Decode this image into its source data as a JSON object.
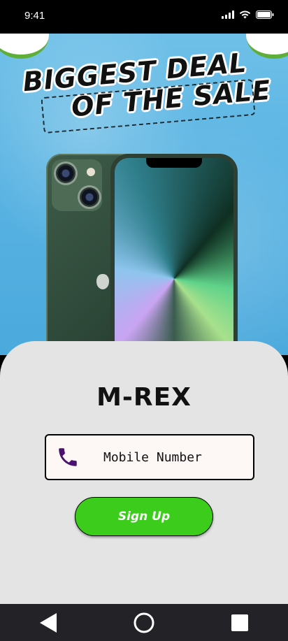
{
  "status_bar": {
    "time": "9:41",
    "icons": [
      "signal-icon",
      "wifi-icon",
      "battery-icon"
    ]
  },
  "hero": {
    "headline_line1": "BIGGEST DEAL",
    "headline_line2": "OF THE SALE",
    "background_color": "#5ab4e3",
    "product": "green smartphone"
  },
  "brand": {
    "name": "M-REX"
  },
  "phone_field": {
    "placeholder": "Mobile Number",
    "value": "",
    "icon": "phone-icon",
    "icon_color": "#4a1170"
  },
  "signup": {
    "label": "Sign Up",
    "color": "#3ccd1c"
  },
  "nav_bar": {
    "buttons": [
      "back-icon",
      "home-icon",
      "recents-icon"
    ]
  }
}
